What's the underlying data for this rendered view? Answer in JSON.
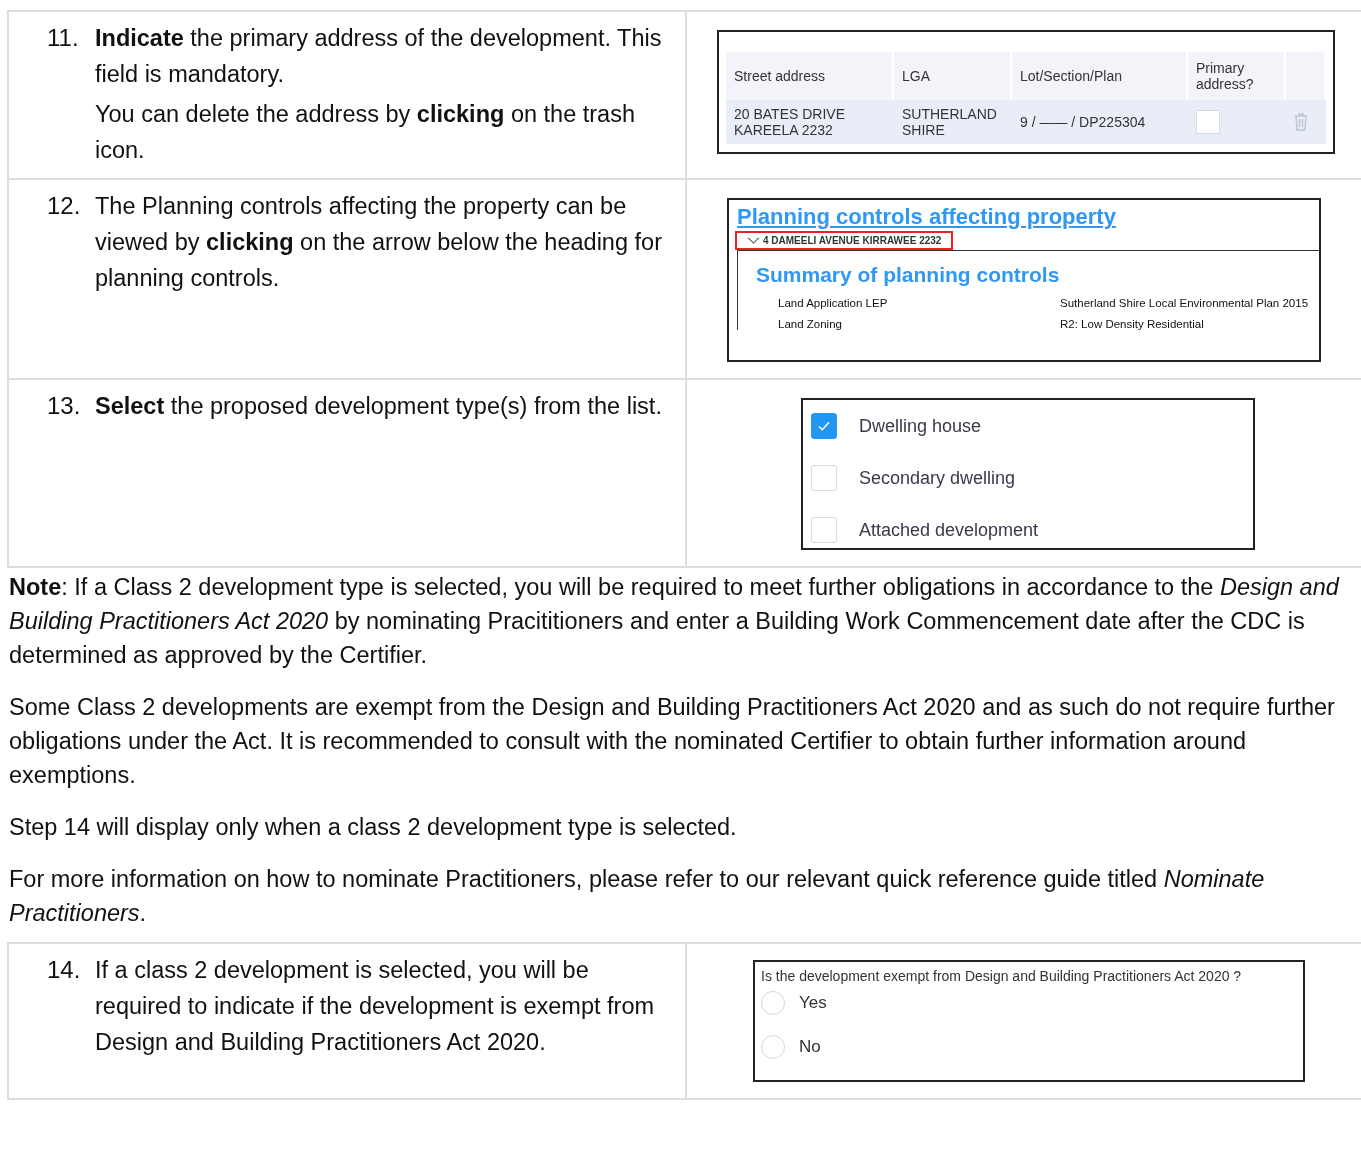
{
  "rows": [
    {
      "kind": "step",
      "number": "11.",
      "paragraphs": [
        "**Indicate** the primary address of the development. This field is mandatory.",
        "You can delete the address by **clicking** on the trash icon."
      ],
      "panel": {
        "kind": "address_table",
        "columns": [
          "Street address",
          "LGA",
          "Lot/Section/Plan",
          "Primary address?"
        ],
        "rows": [
          {
            "street": "20 BATES DRIVE KAREELA 2232",
            "lga": "SUTHERLAND SHIRE",
            "lot": "9 / —— / DP225304",
            "primary": false
          }
        ]
      }
    },
    {
      "kind": "step",
      "number": "12.",
      "paragraphs": [
        "The Planning controls affecting the property can be viewed by **clicking** on the arrow below the heading for planning controls."
      ],
      "panel": {
        "kind": "planning",
        "title": "Planning controls affecting property",
        "address": "4 DAMEELI AVENUE KIRRAWEE 2232",
        "expanded": true,
        "summary_title": "Summary of planning controls",
        "controls": [
          {
            "label": "Land Application LEP",
            "value": "Sutherland Shire Local Environmental Plan 2015"
          },
          {
            "label": "Land Zoning",
            "value": "R2: Low Density Residential"
          }
        ]
      }
    },
    {
      "kind": "step",
      "number": "13.",
      "paragraphs": [
        "**Select** the proposed development type(s) from the list."
      ],
      "panel": {
        "kind": "checklist",
        "options": [
          {
            "label": "Dwelling house",
            "checked": true
          },
          {
            "label": "Secondary dwelling",
            "checked": false
          },
          {
            "label": "Attached development",
            "checked": false
          }
        ]
      }
    },
    {
      "kind": "note",
      "paragraphs": [
        "**Note**:  If a Class 2 development type is selected, you will be required to meet further obligations in accordance to the *Design and Building Practitioners Act 2020* by nominating Pracititioners and enter a Building Work Commencement date after the CDC is determined as approved by the Certifier.",
        "Some Class 2 developments are exempt from the Design and Building Practitioners Act 2020 and as such do not require further obligations under the Act. It is recommended to consult with the nominated Certifier to obtain further information around exemptions.",
        "Step 14 will display only when a class 2 development type is selected.",
        "For more information on how to nominate Practitioners, please refer to our relevant quick reference guide titled *Nominate Practitioners*."
      ]
    },
    {
      "kind": "step",
      "number": "14.",
      "paragraphs": [
        "If a class 2 development is selected, you will be required to indicate if the development is exempt from Design and Building Practitioners Act 2020."
      ],
      "panel": {
        "kind": "radio_question",
        "question": "Is the development exempt from Design and Building Practitioners Act 2020 ?",
        "options": [
          {
            "label": "Yes",
            "selected": false
          },
          {
            "label": "No",
            "selected": false
          }
        ]
      }
    }
  ]
}
